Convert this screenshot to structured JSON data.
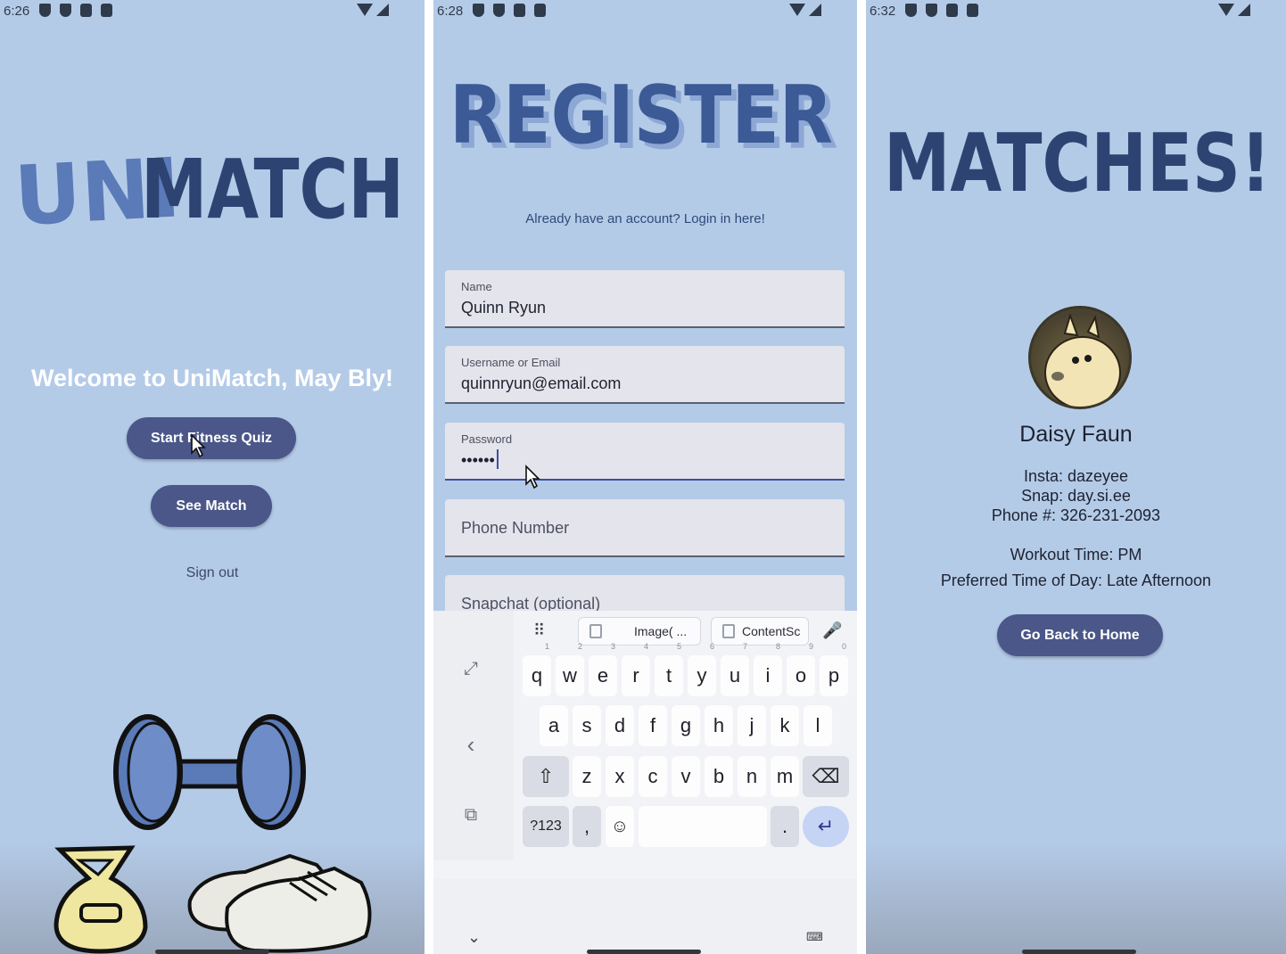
{
  "screens": [
    {
      "status": {
        "time": "6:26"
      },
      "logo": "UNIMATCH",
      "welcome": "Welcome to UniMatch, May Bly!",
      "buttons": {
        "quiz": "Start Fitness Quiz",
        "match": "See Match",
        "signout": "Sign out"
      }
    },
    {
      "status": {
        "time": "6:28"
      },
      "title": "REGISTER",
      "login_link": "Already have an account? Login in here!",
      "fields": [
        {
          "label": "Name",
          "value": "Quinn Ryun"
        },
        {
          "label": "Username or Email",
          "value": "quinnryun@email.com"
        },
        {
          "label": "Password",
          "value": "••••••"
        },
        {
          "placeholder": "Phone Number"
        },
        {
          "placeholder": "Snapchat (optional)"
        }
      ],
      "keyboard": {
        "chips": [
          "Image( ...",
          "ContentSc"
        ],
        "row1": [
          [
            "q",
            "1"
          ],
          [
            "w",
            "2"
          ],
          [
            "e",
            "3"
          ],
          [
            "r",
            "4"
          ],
          [
            "t",
            "5"
          ],
          [
            "y",
            "6"
          ],
          [
            "u",
            "7"
          ],
          [
            "i",
            "8"
          ],
          [
            "o",
            "9"
          ],
          [
            "p",
            "0"
          ]
        ],
        "row2": [
          "a",
          "s",
          "d",
          "f",
          "g",
          "h",
          "j",
          "k",
          "l"
        ],
        "row3": [
          "z",
          "x",
          "c",
          "v",
          "b",
          "n",
          "m"
        ],
        "row4": {
          "symbols": "?123",
          "comma": ",",
          "period": "."
        }
      }
    },
    {
      "status": {
        "time": "6:32"
      },
      "title": "MATCHES!",
      "name": "Daisy Faun",
      "insta": "Insta: dazeyee",
      "snap": "Snap: day.si.ee",
      "phone": "Phone #: 326-231-2093",
      "workout": "Workout Time: PM",
      "preferred": "Preferred Time of Day: Late Afternoon",
      "button": "Go Back to Home"
    }
  ],
  "colors": {
    "background": "#b4cbe8",
    "button": "#4a5788",
    "logo_dark": "#2d4473",
    "logo_light": "#5a7ab8"
  }
}
